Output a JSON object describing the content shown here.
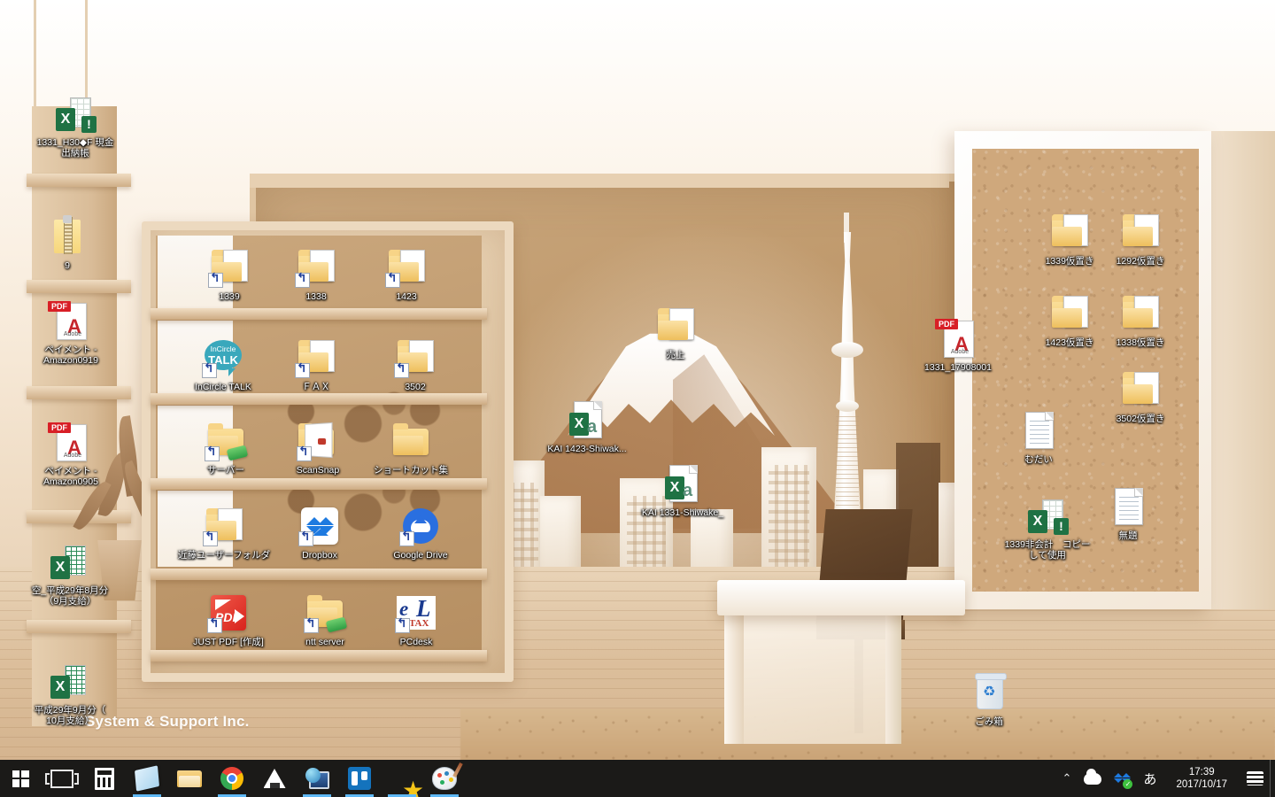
{
  "desktop": {
    "wallpaper_watermark": "System & Support Inc.",
    "theme_colors": {
      "wallpaper_base": "#e9ddcf",
      "wallpaper_wood": "#caa87f",
      "cork_board": "#cfa87c",
      "taskbar": "#1b1a18",
      "taskbar_active_indicator": "#5fb8f5",
      "icon_label_text": "#ffffff"
    },
    "icons": [
      {
        "id": "excel-cash-book",
        "label": "1331_H30◆F 現金\n出納帳",
        "type": "excel-warning"
      },
      {
        "id": "zip-9",
        "label": "9",
        "type": "zip"
      },
      {
        "id": "pdf-amazon0919",
        "label": "ペイメント -\nAmazon0919",
        "type": "pdf"
      },
      {
        "id": "pdf-amazon0905",
        "label": "ペイメント -\nAmazon0905",
        "type": "pdf"
      },
      {
        "id": "excel-kara-h29-8",
        "label": "空_平成29年8月分\n（9月支給）",
        "type": "excel"
      },
      {
        "id": "excel-h29-9",
        "label": "平成29年9月分（\n10月支給）",
        "type": "excel"
      },
      {
        "id": "folder-1339",
        "label": "1339",
        "type": "folder-shortcut-doc"
      },
      {
        "id": "folder-1338",
        "label": "1338",
        "type": "folder-shortcut"
      },
      {
        "id": "folder-1423",
        "label": "1423",
        "type": "folder-shortcut-excel"
      },
      {
        "id": "app-incircle-talk",
        "label": "InCircle TALK",
        "type": "incircle"
      },
      {
        "id": "folder-fax",
        "label": "ＦＡＸ",
        "type": "folder-shortcut-open"
      },
      {
        "id": "folder-3502",
        "label": "3502",
        "type": "folder-shortcut-doc"
      },
      {
        "id": "folder-server",
        "label": "サーバー",
        "type": "folder-network"
      },
      {
        "id": "app-scansnap",
        "label": "ScanSnap",
        "type": "scansnap"
      },
      {
        "id": "folder-shortcuts",
        "label": "ショートカット集",
        "type": "folder"
      },
      {
        "id": "folder-kondo-user",
        "label": "近藤ユーザーフォルダ",
        "type": "folder-shortcut-doc"
      },
      {
        "id": "app-dropbox",
        "label": "Dropbox",
        "type": "dropbox"
      },
      {
        "id": "app-google-drive",
        "label": "Google Drive",
        "type": "gdrive"
      },
      {
        "id": "app-just-pdf",
        "label": "JUST PDF [作成]",
        "type": "justpdf"
      },
      {
        "id": "folder-ntt-server",
        "label": "ntt server",
        "type": "folder-network"
      },
      {
        "id": "app-pcdesk",
        "label": "PCdesk",
        "type": "etax"
      },
      {
        "id": "folder-uriage",
        "label": "売上",
        "type": "folder-shortcut-doc"
      },
      {
        "id": "excel-kai-1423",
        "label": "KAI 1423-Shiwak...",
        "type": "excel-file"
      },
      {
        "id": "excel-kai-1331",
        "label": "KAI 1331-Shiwake_",
        "type": "excel-file"
      },
      {
        "id": "pdf-1331-17908001",
        "label": "1331_17908001",
        "type": "pdf"
      },
      {
        "id": "folder-1339-kari",
        "label": "1339仮置き",
        "type": "folder-doc"
      },
      {
        "id": "folder-1292-kari",
        "label": "1292仮置き",
        "type": "folder-doc"
      },
      {
        "id": "folder-1423-kari",
        "label": "1423仮置き",
        "type": "folder-doc"
      },
      {
        "id": "folder-1338-kari",
        "label": "1338仮置き",
        "type": "folder-doc"
      },
      {
        "id": "folder-3502-kari",
        "label": "3502仮置き",
        "type": "folder-doc"
      },
      {
        "id": "text-mudai",
        "label": "むだい",
        "type": "text"
      },
      {
        "id": "excel-1339-hikaikei",
        "label": "1339非会計　コピー\nして使用",
        "type": "excel-warning"
      },
      {
        "id": "text-mudai2",
        "label": "無題",
        "type": "text"
      },
      {
        "id": "recycle-bin",
        "label": "ごみ箱",
        "type": "recycle"
      }
    ]
  },
  "taskbar": {
    "items": [
      {
        "id": "start",
        "label": "スタート",
        "icon": "windows-logo-icon",
        "active": false
      },
      {
        "id": "task-view",
        "label": "タスク ビュー",
        "icon": "task-view-icon",
        "active": false
      },
      {
        "id": "calculator",
        "label": "電卓",
        "icon": "calculator-icon",
        "active": false
      },
      {
        "id": "sticky-notes",
        "label": "付箋",
        "icon": "sticky-notes-icon",
        "active": true
      },
      {
        "id": "explorer",
        "label": "エクスプローラー",
        "icon": "folder-icon",
        "active": false
      },
      {
        "id": "chrome",
        "label": "Google Chrome",
        "icon": "chrome-icon",
        "active": true
      },
      {
        "id": "onigiri-app",
        "label": "おにぎり",
        "icon": "onigiri-icon",
        "active": false
      },
      {
        "id": "remote-app",
        "label": "リモート",
        "icon": "globe-monitor-icon",
        "active": true
      },
      {
        "id": "trello",
        "label": "Trello",
        "icon": "trello-icon",
        "active": true
      },
      {
        "id": "star-app",
        "label": "お気に入り",
        "icon": "star-icon",
        "active": true
      },
      {
        "id": "paint",
        "label": "ペイント",
        "icon": "paint-palette-icon",
        "active": true
      }
    ],
    "tray": {
      "overflow_label": "隠れているインジケーターを表示します",
      "onedrive_label": "OneDrive",
      "dropbox_label": "Dropbox",
      "ime_label": "あ",
      "time": "17:39",
      "date": "2017/10/17",
      "action_center_label": "アクション センター"
    }
  }
}
